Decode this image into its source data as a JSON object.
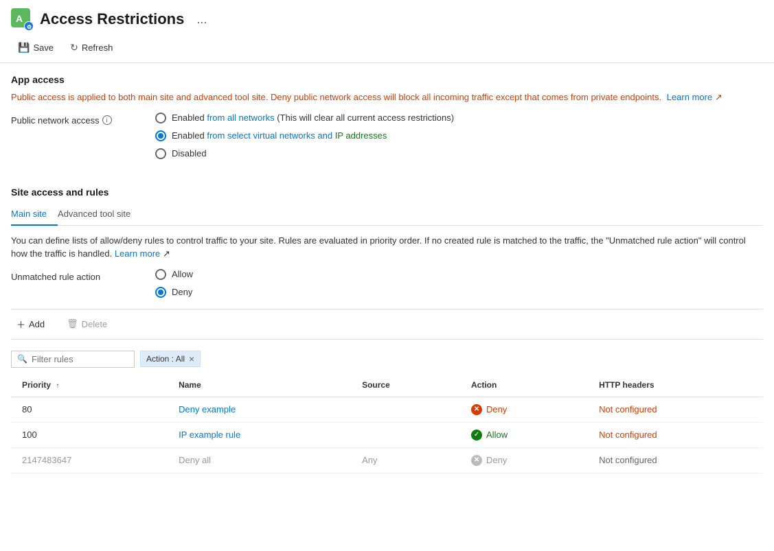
{
  "header": {
    "icon_alt": "Azure App Service Icon",
    "title": "Access Restrictions",
    "ellipsis": "..."
  },
  "toolbar": {
    "save_label": "Save",
    "refresh_label": "Refresh"
  },
  "app_access": {
    "heading": "App access",
    "info_text": "Public access is applied to both main site and advanced tool site. Deny public network access will block all incoming traffic except that comes from private endpoints.",
    "learn_more_label": "Learn more",
    "public_network_access_label": "Public network access",
    "info_tooltip": "i",
    "options": [
      {
        "id": "opt1",
        "label_prefix": "Enabled ",
        "label_highlight": "from all networks",
        "label_suffix": " (This will clear all current access restrictions)",
        "selected": false
      },
      {
        "id": "opt2",
        "label_prefix": "Enabled ",
        "label_highlight_blue": "from select virtual networks and ",
        "label_highlight_green": "IP addresses",
        "selected": true
      },
      {
        "id": "opt3",
        "label": "Disabled",
        "selected": false
      }
    ]
  },
  "site_access": {
    "heading": "Site access and rules",
    "tabs": [
      {
        "id": "main",
        "label": "Main site",
        "active": true
      },
      {
        "id": "advanced",
        "label": "Advanced tool site",
        "active": false
      }
    ],
    "description": "You can define lists of allow/deny rules to control traffic to your site. Rules are evaluated in priority order. If no created rule is matched to the traffic, the \"Unmatched rule action\" will control how the traffic is handled.",
    "learn_more_label": "Learn more",
    "unmatched_rule_label": "Unmatched rule action",
    "unmatched_options": [
      {
        "id": "allow",
        "label": "Allow",
        "selected": false
      },
      {
        "id": "deny",
        "label": "Deny",
        "selected": true
      }
    ]
  },
  "rules_toolbar": {
    "add_label": "Add",
    "delete_label": "Delete"
  },
  "filter": {
    "placeholder": "Filter rules",
    "tag_label": "Action : All",
    "tag_close": "×"
  },
  "table": {
    "columns": [
      {
        "id": "priority",
        "label": "Priority",
        "sortable": true
      },
      {
        "id": "name",
        "label": "Name"
      },
      {
        "id": "source",
        "label": "Source"
      },
      {
        "id": "action",
        "label": "Action"
      },
      {
        "id": "http_headers",
        "label": "HTTP headers"
      }
    ],
    "rows": [
      {
        "priority": "80",
        "name": "Deny example",
        "source": "",
        "action": "Deny",
        "action_type": "deny",
        "http_headers": "Not configured",
        "http_headers_type": "error",
        "muted": false
      },
      {
        "priority": "100",
        "name": "IP example rule",
        "source": "",
        "action": "Allow",
        "action_type": "allow",
        "http_headers": "Not configured",
        "http_headers_type": "error",
        "muted": false
      },
      {
        "priority": "2147483647",
        "name": "Deny all",
        "source": "Any",
        "action": "Deny",
        "action_type": "deny",
        "http_headers": "Not configured",
        "http_headers_type": "gray",
        "muted": true
      }
    ]
  }
}
